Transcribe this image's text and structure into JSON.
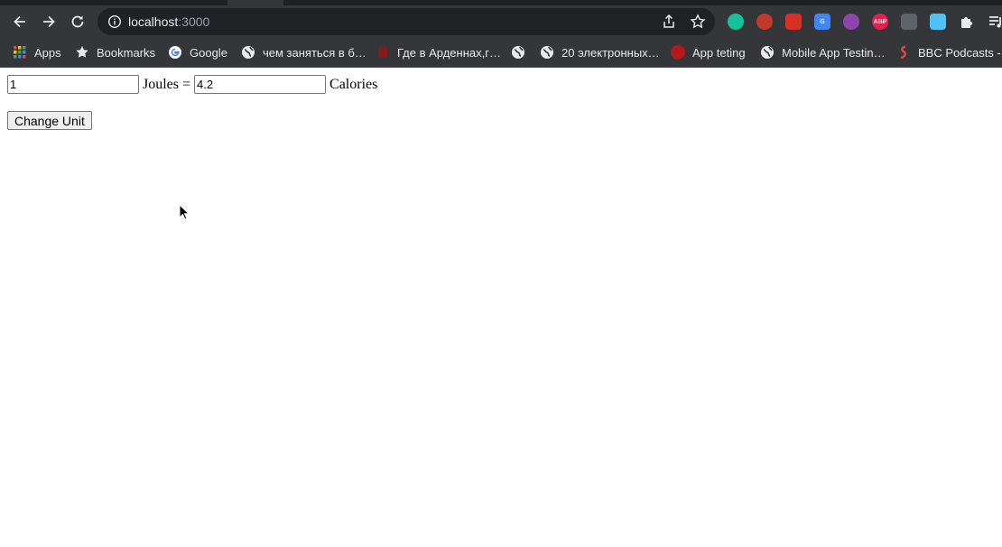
{
  "browser": {
    "url_host": "localhost",
    "url_port": ":3000",
    "extensions": [
      {
        "name": "grammarly-icon",
        "color": "#15c39a",
        "label": ""
      },
      {
        "name": "tomato-icon",
        "color": "#c0392b",
        "label": ""
      },
      {
        "name": "video-speed-icon",
        "color": "#d93025",
        "label": ""
      },
      {
        "name": "translate-icon",
        "color": "#4285f4",
        "label": "G"
      },
      {
        "name": "color-picker-icon",
        "color": "#8e44ad",
        "label": ""
      },
      {
        "name": "adblock-icon",
        "color": "#e2204f",
        "label": "ABP"
      },
      {
        "name": "screen-record-icon",
        "color": "#5f6368",
        "label": ""
      },
      {
        "name": "screenshot-icon",
        "color": "#4fc3f7",
        "label": ""
      },
      {
        "name": "puzzle-icon",
        "color": "#e8eaed",
        "label": ""
      },
      {
        "name": "media-icon",
        "color": "#e8eaed",
        "label": ""
      }
    ]
  },
  "bookmarks": [
    {
      "label": "Apps",
      "icon": "apps-grid-icon"
    },
    {
      "label": "Bookmarks",
      "icon": "star-icon"
    },
    {
      "label": "Google",
      "icon": "google-icon"
    },
    {
      "label": "чем заняться в б…",
      "icon": "globe-icon"
    },
    {
      "label": "Где в Арденнах,г…",
      "icon": "bookmark-favicon-icon"
    },
    {
      "label": "",
      "icon": "globe-icon"
    },
    {
      "label": "20 электронных…",
      "icon": "globe-icon"
    },
    {
      "label": "App teting",
      "icon": "red-circle-icon"
    },
    {
      "label": "Mobile App Testin…",
      "icon": "globe-icon"
    },
    {
      "label": "BBC Podcasts -",
      "icon": "podcast-icon"
    }
  ],
  "converter": {
    "left_value": "1",
    "left_unit": "Joules =",
    "right_value": "4.2",
    "right_unit": "Calories",
    "button_label": "Change Unit"
  }
}
